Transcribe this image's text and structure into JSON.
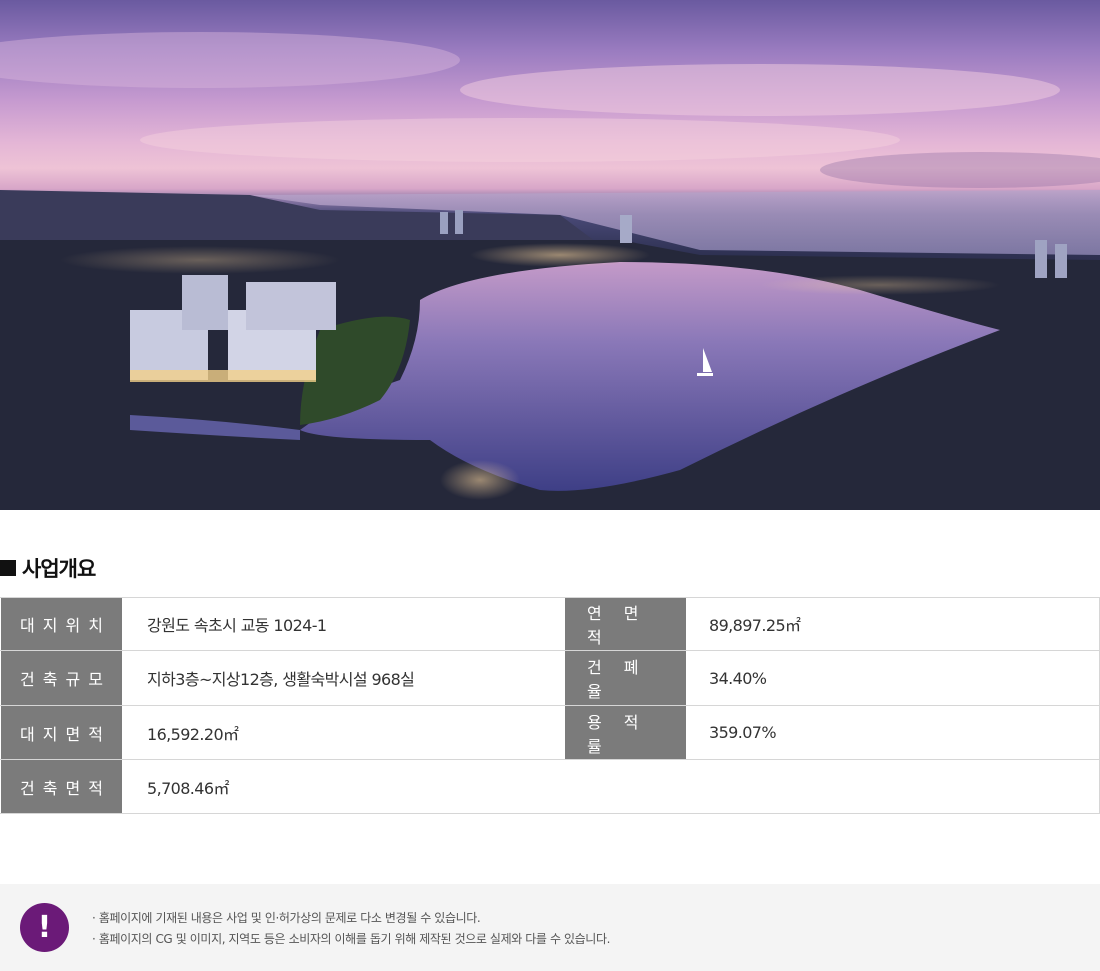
{
  "section": {
    "title": "사업개요"
  },
  "overview": {
    "rows": [
      {
        "label": "대지위치",
        "value": "강원도 속초시 교동 1024-1"
      },
      {
        "label": "건축규모",
        "value": "지하3층~지상12층, 생활숙박시설 968실"
      },
      {
        "label": "대지면적",
        "value": "16,592.20㎡"
      },
      {
        "label": "건축면적",
        "value": "5,708.46㎡"
      }
    ],
    "right_rows": [
      {
        "label": "연면적",
        "value": "89,897.25㎡"
      },
      {
        "label": "건폐율",
        "value": "34.40%"
      },
      {
        "label": "용적률",
        "value": "359.07%"
      }
    ]
  },
  "notice": {
    "icon": "exclamation-icon",
    "lines": [
      "· 홈페이지에 기재된 내용은 사업 및 인·허가상의 문제로 다소 변경될 수 있습니다.",
      "· 홈페이지의 CG 및 이미지, 지역도 등은 소비자의 이해를 돕기 위해 제작된 것으로 실제와 다를 수 있습니다."
    ]
  },
  "colors": {
    "header_cell": "#7b7b7b",
    "notice_icon": "#6b1a78",
    "notice_bg": "#f4f4f4"
  }
}
